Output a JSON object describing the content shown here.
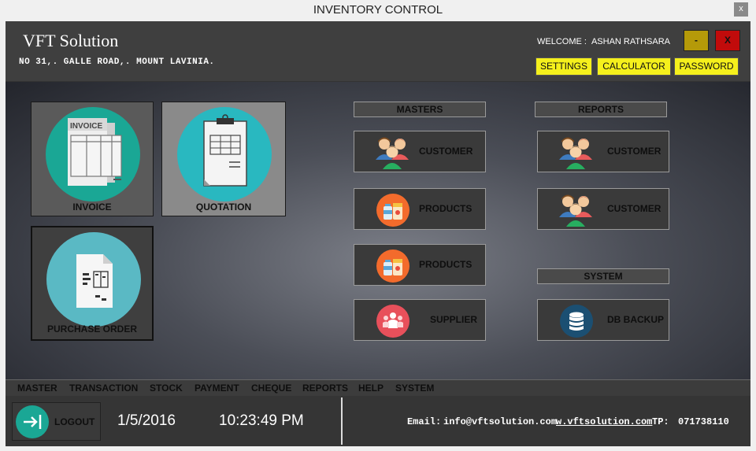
{
  "window": {
    "title": "INVENTORY CONTROL",
    "close_label": "x"
  },
  "header": {
    "company": "VFT Solution",
    "address": "NO 31,. GALLE ROAD,. MOUNT LAVINIA.",
    "welcome_label": "WELCOME :",
    "user_name": "ASHAN RATHSARA",
    "minimize_label": "-",
    "close_label": "X",
    "buttons": {
      "settings": "SETTINGS",
      "calculator": "CALCULATOR",
      "password": "PASSWORD"
    }
  },
  "tiles": {
    "invoice": {
      "label": "INVOICE",
      "doc_text": "INVOICE"
    },
    "quotation": {
      "label": "QUOTATION"
    },
    "purchase_order": {
      "label": "PURCHASE ORDER"
    }
  },
  "masters": {
    "title": "MASTERS",
    "items": [
      {
        "label": "CUSTOMER",
        "icon": "people-icon"
      },
      {
        "label": "PRODUCTS",
        "icon": "products-icon"
      },
      {
        "label": "PRODUCTS",
        "icon": "products-icon"
      },
      {
        "label": "SUPPLIER",
        "icon": "supplier-icon"
      }
    ]
  },
  "reports": {
    "title": "REPORTS",
    "items": [
      {
        "label": "CUSTOMER",
        "icon": "people-icon"
      },
      {
        "label": "CUSTOMER",
        "icon": "people-icon"
      }
    ]
  },
  "system": {
    "title": "SYSTEM",
    "items": [
      {
        "label": "DB BACKUP",
        "icon": "database-icon"
      }
    ]
  },
  "menu": [
    "MASTER",
    "TRANSACTION",
    "STOCK",
    "PAYMENT",
    "CHEQUE",
    "REPORTS",
    "HELP",
    "SYSTEM"
  ],
  "footer": {
    "logout_label": "LOGOUT",
    "date": "1/5/2016",
    "time": "10:23:49 PM",
    "email_label": "Email:",
    "email": "info@vftsolution.com",
    "website": "w.vftsolution.com",
    "tp_label": "TP:",
    "phone": "071738110"
  },
  "colors": {
    "accent_yellow": "#f5f01c",
    "teal": "#1aa795",
    "cyan": "#29b8c0",
    "light_cyan": "#5ab9c4",
    "orange": "#f36b2c",
    "red": "#e8505b",
    "navy": "#1b4f72"
  }
}
